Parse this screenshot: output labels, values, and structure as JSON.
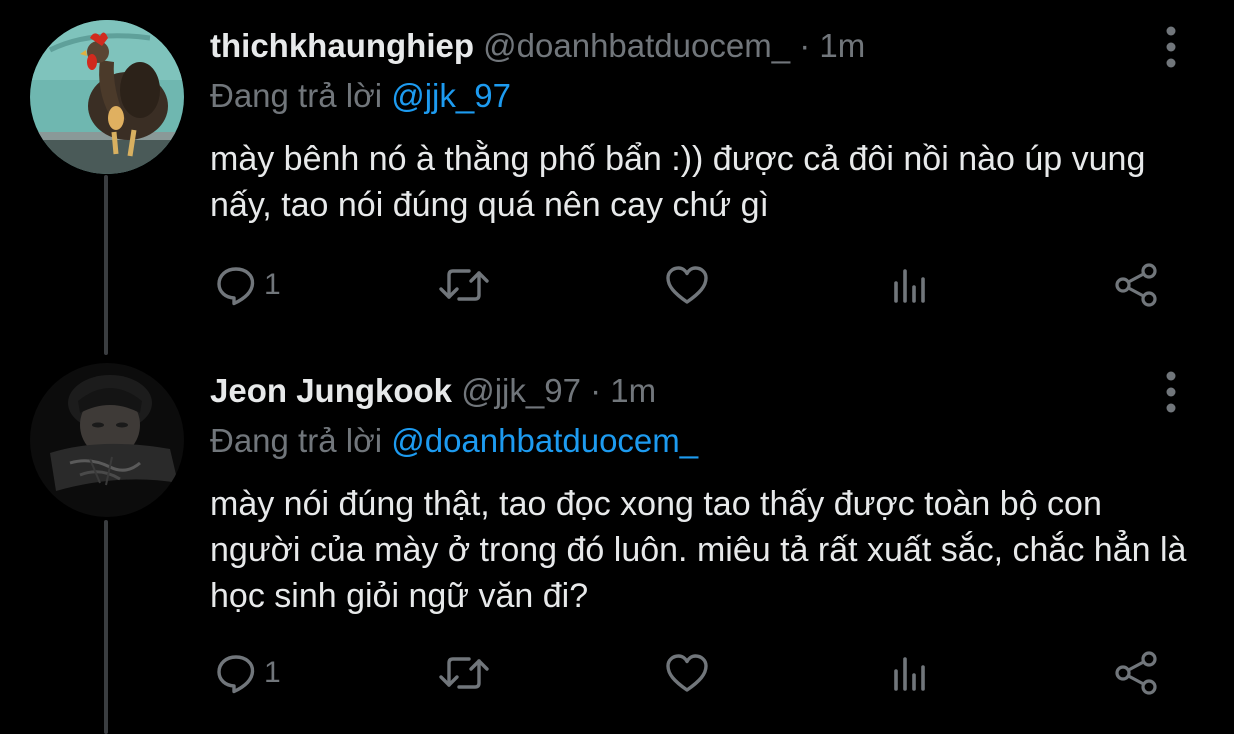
{
  "tweets": [
    {
      "display_name": "thichkhaunghiep",
      "handle": "@doanhbatduocem_",
      "separator": "·",
      "time": "1m",
      "reply_prefix": "Đang trả lời",
      "reply_to": "@jjk_97",
      "text": "mày bênh nó à thằng phố bẩn :)) được cả đôi nồi nào úp vung nấy, tao nói đúng quá nên cay chứ gì",
      "reply_count": "1",
      "avatar_icon": "rooster-avatar"
    },
    {
      "display_name": "Jeon Jungkook",
      "handle": "@jjk_97",
      "separator": "·",
      "time": "1m",
      "reply_prefix": "Đang trả lời",
      "reply_to": "@doanhbatduocem_",
      "text": "mày nói đúng thật, tao đọc xong tao thấy được toàn bộ con người của mày ở trong đó luôn. miêu tả rất xuất sắc, chắc hẳn là học sinh giỏi ngữ văn đi?",
      "reply_count": "1",
      "avatar_icon": "person-avatar"
    }
  ],
  "icons": {
    "reply": "speech-bubble-icon",
    "retweet": "retweet-icon",
    "like": "heart-icon",
    "analytics": "bar-chart-icon",
    "share": "share-icon",
    "more": "vertical-dots-icon"
  },
  "colors": {
    "background": "#000000",
    "primary_text": "#e7e9ea",
    "secondary_text": "#71767b",
    "mention": "#1d9bf0",
    "thread_line": "#3a3d40"
  }
}
